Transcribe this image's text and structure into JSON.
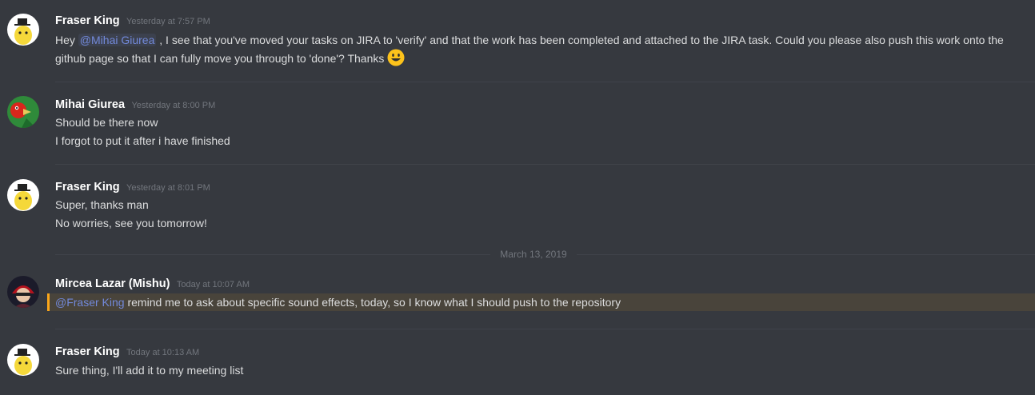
{
  "messages": [
    {
      "author": "Fraser King",
      "timestamp": "Yesterday at 7:57 PM",
      "lines": [
        {
          "pre": "Hey ",
          "mention": "@Mihai Giurea",
          "post": " , I see that you've moved your tasks on JIRA to 'verify' and that the work has been completed and attached to the JIRA task. Could you please also push this work onto the github page so that I can fully move you through to 'done'? Thanks ",
          "emoji": "smiley-icon"
        }
      ]
    },
    {
      "author": "Mihai Giurea",
      "timestamp": "Yesterday at 8:00 PM",
      "lines": [
        "Should be there now",
        "I forgot to put it after i have finished"
      ]
    },
    {
      "author": "Fraser King",
      "timestamp": "Yesterday at 8:01 PM",
      "lines": [
        "Super, thanks man",
        "No worries, see you tomorrow!"
      ]
    },
    {
      "author": "Mircea Lazar (Mishu)",
      "timestamp": "Today at 10:07 AM",
      "mention": "@Fraser King",
      "text": " remind me to ask about specific sound effects, today, so I know what I should push to the repository"
    },
    {
      "author": "Fraser King",
      "timestamp": "Today at 10:13 AM",
      "lines": [
        "Sure thing, I'll add it to my meeting list"
      ]
    }
  ],
  "date_divider": "March 13, 2019",
  "colors": {
    "background": "#36393f",
    "mention": "#7289da",
    "highlight_bar": "#faa61a"
  }
}
